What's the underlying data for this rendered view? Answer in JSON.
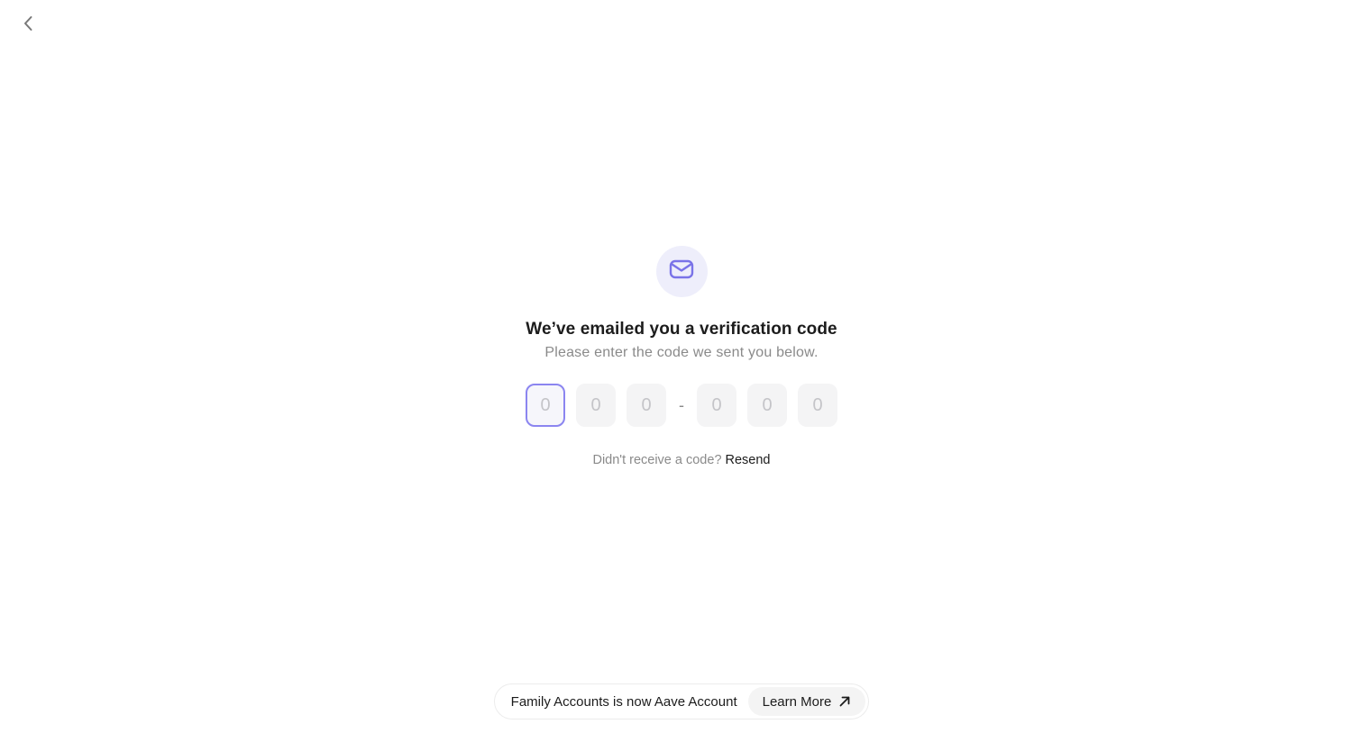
{
  "nav": {
    "back_icon": "chevron-left-icon"
  },
  "verify": {
    "icon": "mail-icon",
    "accent_color": "#7a73e8",
    "title": "We’ve emailed you a verification code",
    "subtitle": "Please enter the code we sent you below.",
    "code": {
      "placeholders": [
        "0",
        "0",
        "0",
        "0",
        "0",
        "0"
      ],
      "values": [
        "",
        "",
        "",
        "",
        "",
        ""
      ],
      "separator": "-",
      "focused_index": 0
    },
    "resend_prompt": "Didn't receive a code?",
    "resend_label": "Resend"
  },
  "banner": {
    "text": "Family Accounts is now Aave Account",
    "button_label": "Learn More",
    "button_icon": "arrow-up-right-icon"
  }
}
